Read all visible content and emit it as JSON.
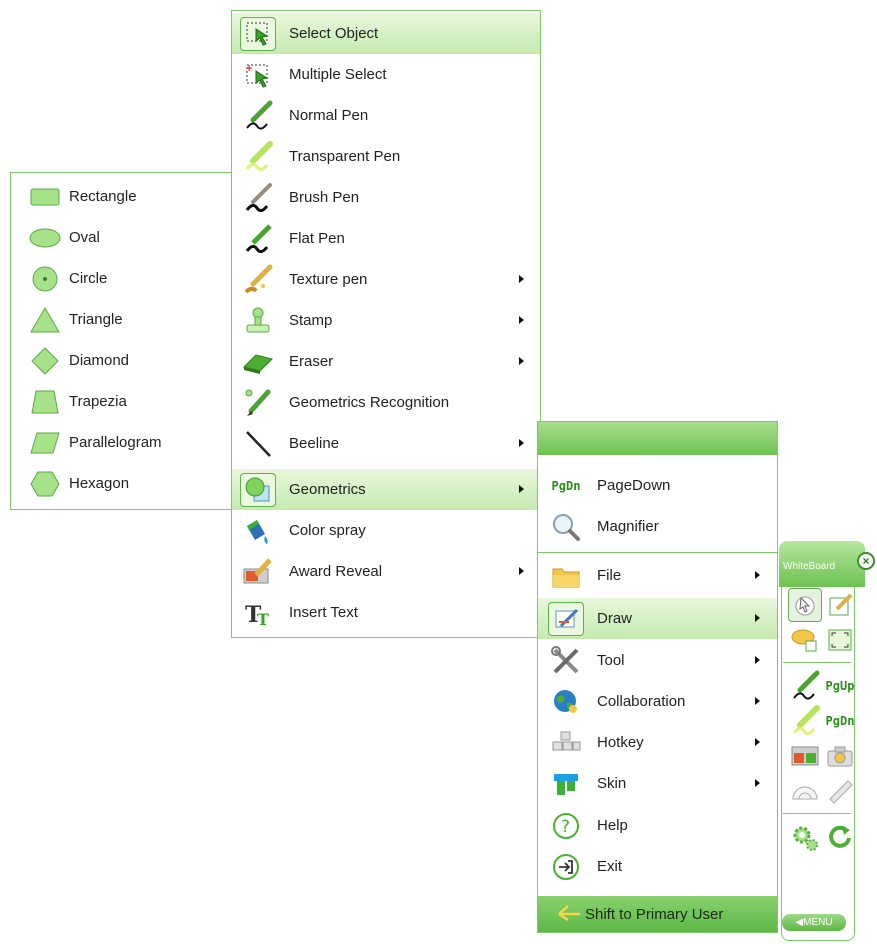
{
  "shapes_menu": {
    "items": [
      {
        "label": "Rectangle",
        "icon": "rectangle-icon"
      },
      {
        "label": "Oval",
        "icon": "oval-icon"
      },
      {
        "label": "Circle",
        "icon": "circle-icon"
      },
      {
        "label": "Triangle",
        "icon": "triangle-icon"
      },
      {
        "label": "Diamond",
        "icon": "diamond-icon"
      },
      {
        "label": "Trapezia",
        "icon": "trapezia-icon"
      },
      {
        "label": "Parallelogram",
        "icon": "parallelogram-icon"
      },
      {
        "label": "Hexagon",
        "icon": "hexagon-icon"
      }
    ]
  },
  "draw_menu": {
    "items": [
      {
        "label": "Select Object",
        "icon": "select-object-icon",
        "selected": true
      },
      {
        "label": "Multiple Select",
        "icon": "multiple-select-icon"
      },
      {
        "label": "Normal Pen",
        "icon": "normal-pen-icon"
      },
      {
        "label": "Transparent Pen",
        "icon": "transparent-pen-icon"
      },
      {
        "label": "Brush Pen",
        "icon": "brush-pen-icon"
      },
      {
        "label": "Flat Pen",
        "icon": "flat-pen-icon"
      },
      {
        "label": "Texture pen",
        "icon": "texture-pen-icon",
        "submenu": true
      },
      {
        "label": "Stamp",
        "icon": "stamp-icon",
        "submenu": true
      },
      {
        "label": "Eraser",
        "icon": "eraser-icon",
        "submenu": true
      },
      {
        "label": "Geometrics Recognition",
        "icon": "geometrics-recognition-icon"
      },
      {
        "label": "Beeline",
        "icon": "beeline-icon",
        "submenu": true
      },
      {
        "label": "Geometrics",
        "icon": "geometrics-icon",
        "submenu": true,
        "selected": true
      },
      {
        "label": "Color spray",
        "icon": "color-spray-icon"
      },
      {
        "label": "Award Reveal",
        "icon": "award-reveal-icon",
        "submenu": true
      },
      {
        "label": "Insert Text",
        "icon": "insert-text-icon"
      }
    ]
  },
  "main_menu": {
    "top_items": [
      {
        "label": "PageDown",
        "icon": "pagedown-icon",
        "icon_text": "PgDn"
      },
      {
        "label": "Magnifier",
        "icon": "magnifier-icon"
      }
    ],
    "items": [
      {
        "label": "File",
        "icon": "folder-icon",
        "submenu": true
      },
      {
        "label": "Draw",
        "icon": "draw-icon",
        "submenu": true,
        "selected": true
      },
      {
        "label": "Tool",
        "icon": "tool-icon",
        "submenu": true
      },
      {
        "label": "Collaboration",
        "icon": "globe-icon",
        "submenu": true
      },
      {
        "label": "Hotkey",
        "icon": "keyboard-icon",
        "submenu": true
      },
      {
        "label": "Skin",
        "icon": "skin-icon",
        "submenu": true
      },
      {
        "label": "Help",
        "icon": "help-icon"
      },
      {
        "label": "Exit",
        "icon": "exit-icon"
      }
    ],
    "footer_label": "Shift to Primary User"
  },
  "whiteboard": {
    "title": "WhiteBoard",
    "pgup": "PgUp",
    "pgdn": "PgDn",
    "menu_tab": "MENU"
  },
  "colors": {
    "accent": "#6cc24f",
    "border": "#7dc86a",
    "selected_bg": "#c5eab0"
  }
}
